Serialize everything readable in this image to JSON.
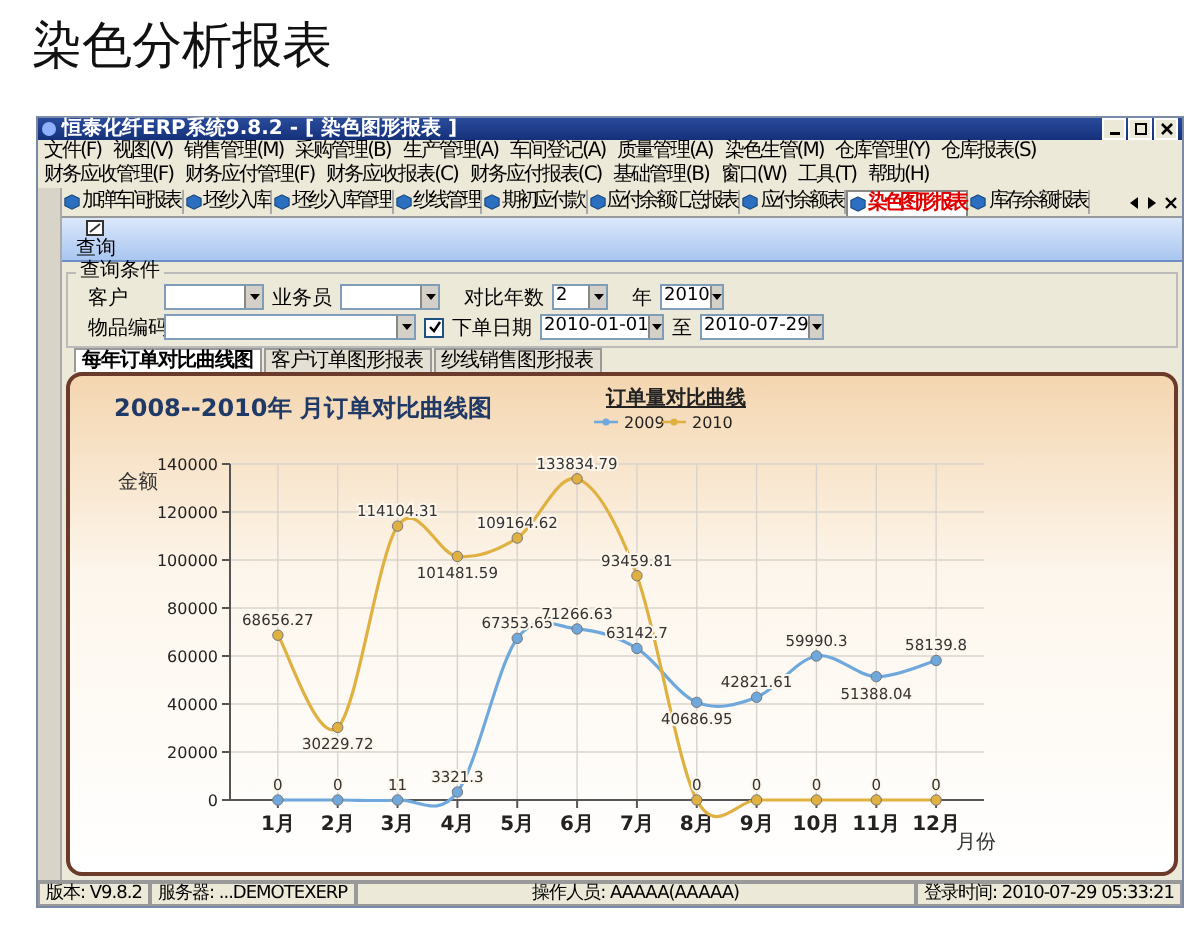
{
  "page_title": "染色分析报表",
  "window": {
    "title": "恒泰化纤ERP系统9.8.2 - [ 染色图形报表 ]"
  },
  "menu": [
    "文件(F)",
    "视图(V)",
    "销售管理(M)",
    "采购管理(B)",
    "生产管理(A)",
    "车间登记(A)",
    "质量管理(A)",
    "染色生管(M)",
    "仓库管理(Y)",
    "仓库报表(S)",
    "财务应收管理(F)",
    "财务应付管理(F)",
    "财务应收报表(C)",
    "财务应付报表(C)",
    "基础管理(B)",
    "窗口(W)",
    "工具(T)",
    "帮助(H)"
  ],
  "doc_tabs": [
    {
      "label": "加弹车间报表",
      "selected": false
    },
    {
      "label": "坯纱入库",
      "selected": false
    },
    {
      "label": "坯纱入库管理",
      "selected": false
    },
    {
      "label": "纱线管理",
      "selected": false
    },
    {
      "label": "期初应付款",
      "selected": false
    },
    {
      "label": "应付余额汇总报表",
      "selected": false
    },
    {
      "label": "应付余额表",
      "selected": false
    },
    {
      "label": "染色图形报表",
      "selected": true
    },
    {
      "label": "库存余额报表",
      "selected": false
    }
  ],
  "toolbar": {
    "query_button": "查询"
  },
  "filters": {
    "title": "查询条件",
    "customer_label": "客户",
    "salesman_label": "业务员",
    "years_label": "对比年数",
    "years_value": "2",
    "year_label": "年",
    "year_value": "2010",
    "item_label": "物品编码",
    "order_date": {
      "label": "下单日期",
      "checked": true
    },
    "date_from": "2010-01-01",
    "to_label": "至",
    "date_to": "2010-07-29"
  },
  "chart_tabs": [
    {
      "label": "每年订单对比曲线图",
      "selected": true
    },
    {
      "label": "客户订单图形报表",
      "selected": false
    },
    {
      "label": "纱线销售图形报表",
      "selected": false
    }
  ],
  "chart": {
    "legend_title": "订单量对比曲线",
    "chart_data": {
      "type": "line",
      "title": "2008--2010年 月订单对比曲线图",
      "xlabel": "月份",
      "ylabel": "金额",
      "categories": [
        "1月",
        "2月",
        "3月",
        "4月",
        "5月",
        "6月",
        "7月",
        "8月",
        "9月",
        "10月",
        "11月",
        "12月"
      ],
      "series": [
        {
          "name": "2009",
          "color": "#6fa8dc",
          "marker": "circle",
          "values": [
            0,
            0,
            11,
            3321.3,
            67353.65,
            71266.63,
            63142.7,
            40686.95,
            42821.61,
            59990.3,
            51388.04,
            58139.8
          ]
        },
        {
          "name": "2010",
          "color": "#e0b040",
          "marker": "circle",
          "values": [
            68656.27,
            30229.72,
            114104.31,
            101481.59,
            109164.62,
            133834.79,
            93459.81,
            0,
            0,
            0,
            0,
            0
          ]
        }
      ],
      "ylim": [
        0,
        140000
      ],
      "yticks": [
        0,
        20000,
        40000,
        60000,
        80000,
        100000,
        120000,
        140000
      ],
      "data_labels": true,
      "grid": true,
      "legend": true
    }
  },
  "status_bar": {
    "version": "版本: V9.8.2",
    "server": "服务器: ...DEMOTEXERP",
    "operator": "操作人员: AAAAA(AAAAA)",
    "login_time": "登录时间: 2010-07-29 05:33:21"
  }
}
